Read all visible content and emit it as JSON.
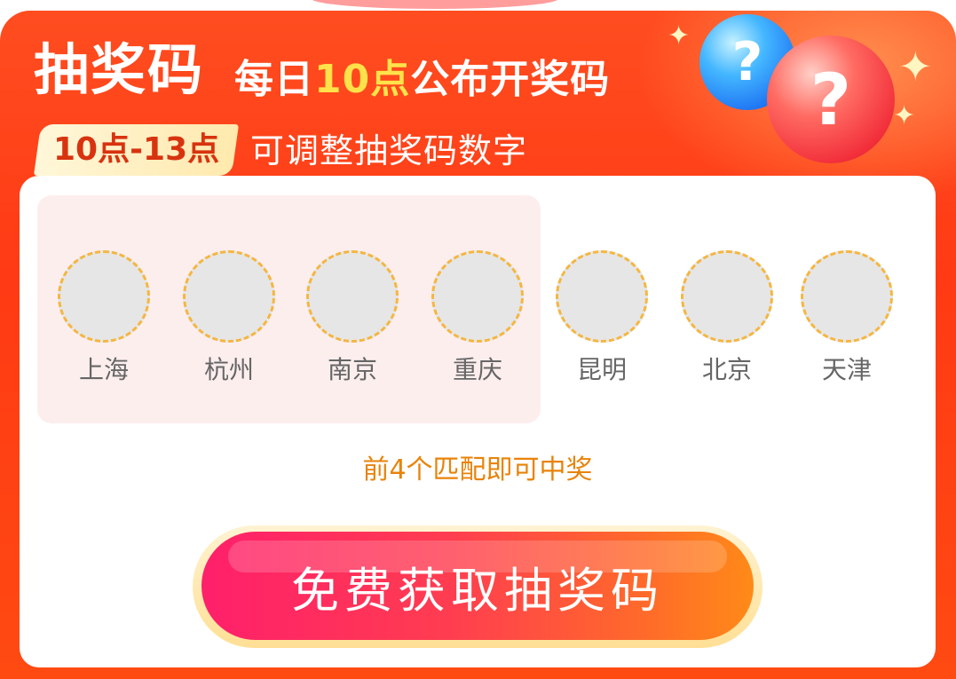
{
  "header": {
    "title": "抽奖码",
    "subtitle_prefix": "每日",
    "subtitle_highlight": "10点",
    "subtitle_suffix": "公布开奖码",
    "time_badge": "10点-13点",
    "badge_note": "可调整抽奖码数字"
  },
  "decor": {
    "ball_blue_icon": "question-ball-blue",
    "ball_blue_symbol": "?",
    "ball_red_icon": "question-ball-red",
    "ball_red_symbol": "?",
    "sparkle_icon": "sparkle",
    "sparkle_symbol": "✦"
  },
  "slots": {
    "matched_count_to_win": 4,
    "items": [
      {
        "label": "上海",
        "value": ""
      },
      {
        "label": "杭州",
        "value": ""
      },
      {
        "label": "南京",
        "value": ""
      },
      {
        "label": "重庆",
        "value": ""
      },
      {
        "label": "昆明",
        "value": ""
      },
      {
        "label": "北京",
        "value": ""
      },
      {
        "label": "天津",
        "value": ""
      }
    ]
  },
  "hint": "前4个匹配即可中奖",
  "cta": {
    "label": "免费获取抽奖码"
  },
  "colors": {
    "header_red": "#ff3a14",
    "accent_yellow": "#ffe24a",
    "hint_orange": "#e8830a",
    "slot_border": "#f5b640",
    "match_zone": "#fdeeee",
    "cta_start": "#ff1f6b",
    "cta_end": "#ff8a18"
  }
}
